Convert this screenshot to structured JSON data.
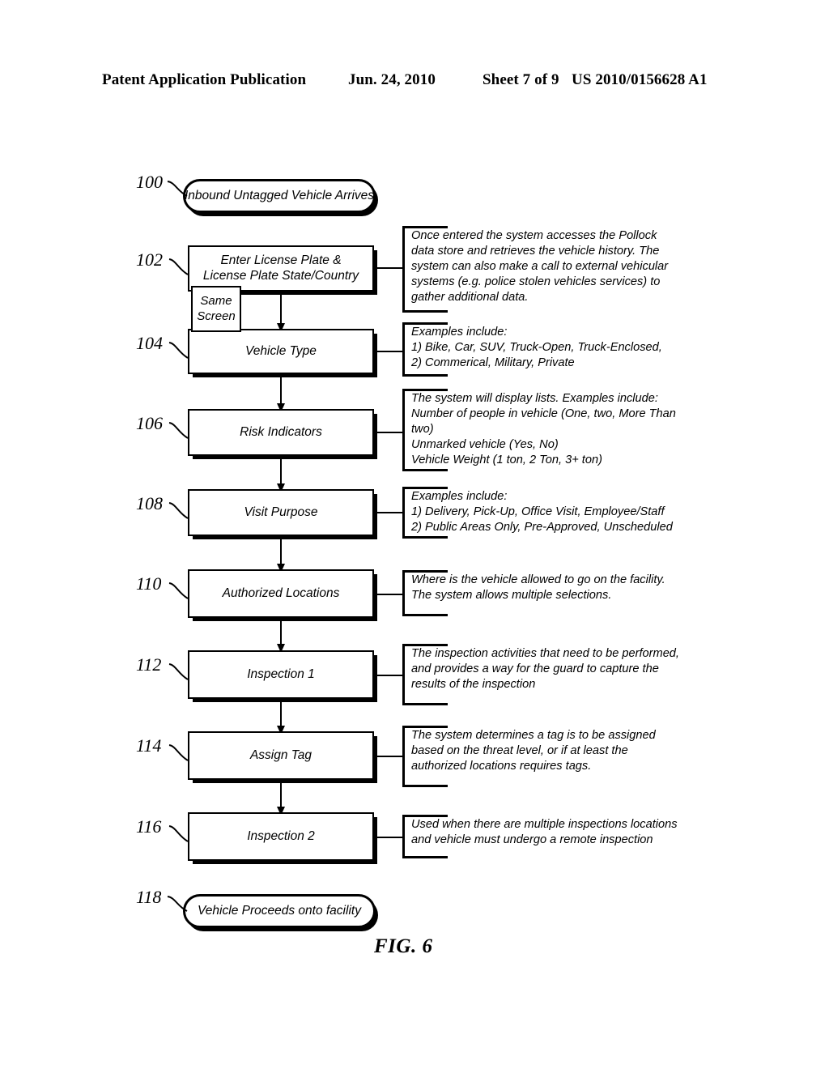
{
  "header": {
    "publication": "Patent Application Publication",
    "date": "Jun. 24, 2010",
    "sheet": "Sheet 7 of 9",
    "number": "US 2010/0156628 A1"
  },
  "figure": {
    "caption": "FIG. 6",
    "callout": {
      "label": "Same\nScreen",
      "name": "same-screen-callout"
    }
  },
  "nodes": [
    {
      "ref": "100",
      "shape": "terminator",
      "label": "Inbound Untagged Vehicle Arrives",
      "annotation": null
    },
    {
      "ref": "102",
      "shape": "process",
      "label": "Enter License Plate & License Plate State/Country",
      "annotation": "Once entered the system accesses the Pollock data store and retrieves the vehicle history. The system can also make a call to external vehicular systems (e.g. police stolen vehicles services) to gather additional data."
    },
    {
      "ref": "104",
      "shape": "process",
      "label": "Vehicle Type",
      "annotation": "Examples include:\n1) Bike, Car, SUV, Truck-Open, Truck-Enclosed,\n2) Commerical, Military, Private"
    },
    {
      "ref": "106",
      "shape": "process",
      "label": "Risk Indicators",
      "annotation": "The system will display lists. Examples include:\nNumber of people in vehicle (One, two, More Than two)\nUnmarked vehicle (Yes, No)\nVehicle Weight (1 ton, 2 Ton, 3+ ton)"
    },
    {
      "ref": "108",
      "shape": "process",
      "label": "Visit Purpose",
      "annotation": "Examples include:\n1) Delivery, Pick-Up, Office Visit, Employee/Staff\n2) Public Areas Only, Pre-Approved, Unscheduled"
    },
    {
      "ref": "110",
      "shape": "process",
      "label": "Authorized Locations",
      "annotation": "Where is the vehicle allowed to go on the facility. The system allows multiple selections."
    },
    {
      "ref": "112",
      "shape": "process",
      "label": "Inspection 1",
      "annotation": "The inspection activities that need to be performed, and provides a way for the guard to capture the results of the inspection"
    },
    {
      "ref": "114",
      "shape": "process",
      "label": "Assign Tag",
      "annotation": "The system determines a tag is to be assigned based on the threat level, or if at least the authorized locations requires tags."
    },
    {
      "ref": "116",
      "shape": "process",
      "label": "Inspection 2",
      "annotation": "Used when there are multiple inspections locations and vehicle must undergo a remote inspection"
    },
    {
      "ref": "118",
      "shape": "terminator",
      "label": "Vehicle Proceeds onto facility",
      "annotation": null
    }
  ],
  "colors": {
    "ink": "#000000",
    "paper": "#ffffff"
  }
}
